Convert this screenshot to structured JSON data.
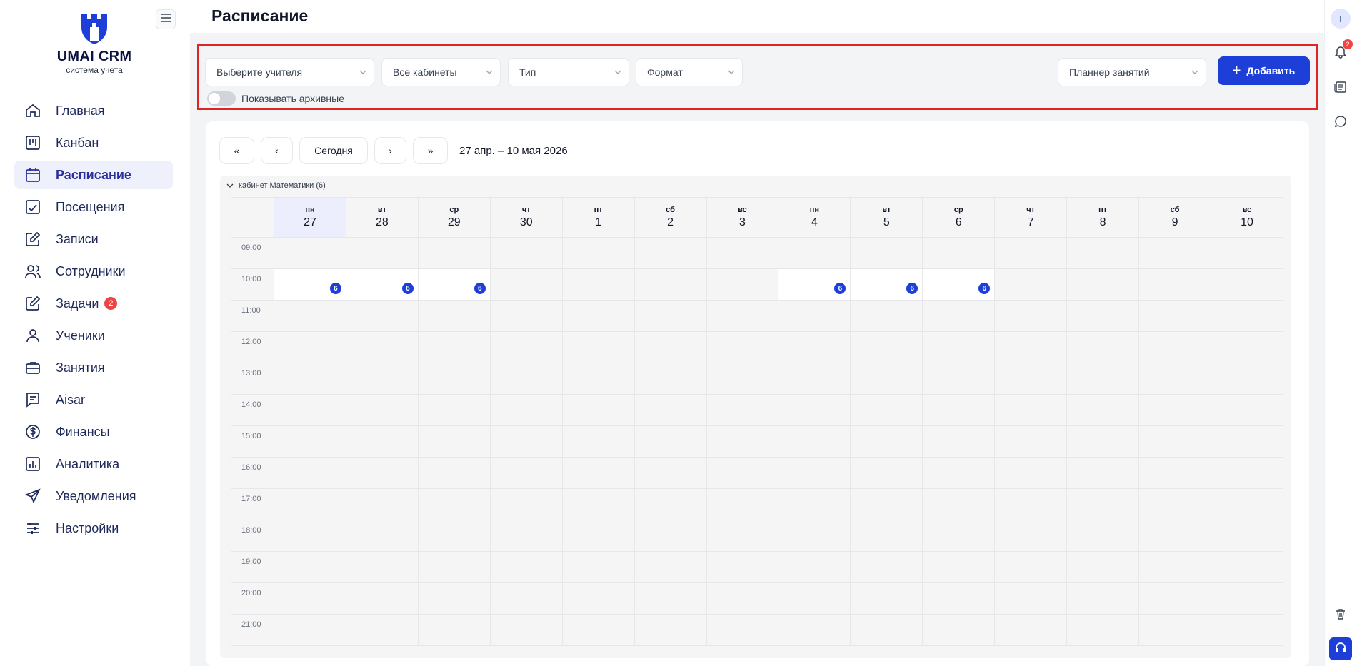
{
  "app": {
    "brand_title": "UMAI CRM",
    "brand_subtitle": "система учета",
    "page_title": "Расписание"
  },
  "sidebar": {
    "items": [
      {
        "label": "Главная",
        "icon": "home-icon"
      },
      {
        "label": "Канбан",
        "icon": "kanban-icon"
      },
      {
        "label": "Расписание",
        "icon": "calendar-icon",
        "active": true
      },
      {
        "label": "Посещения",
        "icon": "attendance-icon"
      },
      {
        "label": "Записи",
        "icon": "edit-icon"
      },
      {
        "label": "Сотрудники",
        "icon": "users-icon"
      },
      {
        "label": "Задачи",
        "icon": "tasks-icon",
        "badge": "2"
      },
      {
        "label": "Ученики",
        "icon": "user-icon"
      },
      {
        "label": "Занятия",
        "icon": "briefcase-icon"
      },
      {
        "label": "Aisar",
        "icon": "chat-doc-icon"
      },
      {
        "label": "Финансы",
        "icon": "dollar-icon"
      },
      {
        "label": "Аналитика",
        "icon": "chart-icon"
      },
      {
        "label": "Уведомления",
        "icon": "send-icon"
      },
      {
        "label": "Настройки",
        "icon": "sliders-icon"
      }
    ]
  },
  "filters": {
    "teacher": "Выберите учителя",
    "rooms": "Все кабинеты",
    "type": "Тип",
    "format": "Формат",
    "planner": "Планнер занятий",
    "add_label": "Добавить",
    "archive_label": "Показывать архивные",
    "archive_on": false
  },
  "calendar": {
    "btn_first": "«",
    "btn_prev": "‹",
    "btn_today": "Сегодня",
    "btn_next": "›",
    "btn_last": "»",
    "range": "27 апр. – 10 мая 2026",
    "group_label": "кабинет Математики (6)",
    "days": [
      {
        "dow": "пн",
        "num": "27",
        "today": true
      },
      {
        "dow": "вт",
        "num": "28"
      },
      {
        "dow": "ср",
        "num": "29"
      },
      {
        "dow": "чт",
        "num": "30"
      },
      {
        "dow": "пт",
        "num": "1"
      },
      {
        "dow": "сб",
        "num": "2"
      },
      {
        "dow": "вс",
        "num": "3"
      },
      {
        "dow": "пн",
        "num": "4"
      },
      {
        "dow": "вт",
        "num": "5"
      },
      {
        "dow": "ср",
        "num": "6"
      },
      {
        "dow": "чт",
        "num": "7"
      },
      {
        "dow": "пт",
        "num": "8"
      },
      {
        "dow": "сб",
        "num": "9"
      },
      {
        "dow": "вс",
        "num": "10"
      }
    ],
    "times": [
      "09:00",
      "10:00",
      "11:00",
      "12:00",
      "13:00",
      "14:00",
      "15:00",
      "16:00",
      "17:00",
      "18:00",
      "19:00",
      "20:00",
      "21:00"
    ],
    "events": [
      {
        "time": "10:00",
        "day": 0,
        "label": "6"
      },
      {
        "time": "10:00",
        "day": 1,
        "label": "6"
      },
      {
        "time": "10:00",
        "day": 2,
        "label": "6"
      },
      {
        "time": "10:00",
        "day": 7,
        "label": "6"
      },
      {
        "time": "10:00",
        "day": 8,
        "label": "6"
      },
      {
        "time": "10:00",
        "day": 9,
        "label": "6"
      }
    ]
  },
  "rail": {
    "avatar": "T",
    "notif_count": "2"
  },
  "colors": {
    "primary": "#1d3fd8",
    "highlight_border": "#dc2626",
    "badge": "#ef4444",
    "active_nav_bg": "#eef0fb"
  }
}
